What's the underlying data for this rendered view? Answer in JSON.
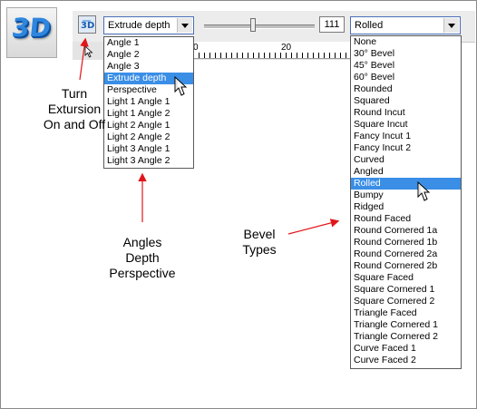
{
  "logo": {
    "text": "3D"
  },
  "toolbar": {
    "extrude_select_value": "Extrude depth",
    "depth_value": "111",
    "bevel_select_value": "Rolled",
    "ruler_labels": [
      "0",
      "20"
    ]
  },
  "extrude_menu": {
    "items": [
      "Angle 1",
      "Angle 2",
      "Angle 3",
      "Extrude depth",
      "Perspective",
      "Light 1 Angle 1",
      "Light 1 Angle 2",
      "Light 2 Angle 1",
      "Light 2 Angle 2",
      "Light 3 Angle 1",
      "Light 3 Angle 2"
    ],
    "selected_index": 3
  },
  "bevel_menu": {
    "items": [
      "None",
      "30° Bevel",
      "45° Bevel",
      "60° Bevel",
      "Rounded",
      "Squared",
      "Round Incut",
      "Square Incut",
      "Fancy Incut 1",
      "Fancy Incut 2",
      "Curved",
      "Angled",
      "Rolled",
      "Bumpy",
      "Ridged",
      "Round Faced",
      "Round Cornered 1a",
      "Round Cornered 1b",
      "Round Cornered 2a",
      "Round Cornered 2b",
      "Square Faced",
      "Square Cornered 1",
      "Square Cornered 2",
      "Triangle Faced",
      "Triangle Cornered 1",
      "Triangle Cornered 2",
      "Curve Faced 1",
      "Curve Faced 2"
    ],
    "selected_index": 12
  },
  "annotations": {
    "toggle": [
      "Turn",
      "Extursion",
      "On and Off"
    ],
    "angles": [
      "Angles",
      "Depth",
      "Perspective"
    ],
    "bevel": [
      "Bevel",
      "Types"
    ]
  },
  "colors": {
    "selection": "#3a8ee6",
    "arrow": "#e0161b",
    "logo": "#2e86de"
  }
}
